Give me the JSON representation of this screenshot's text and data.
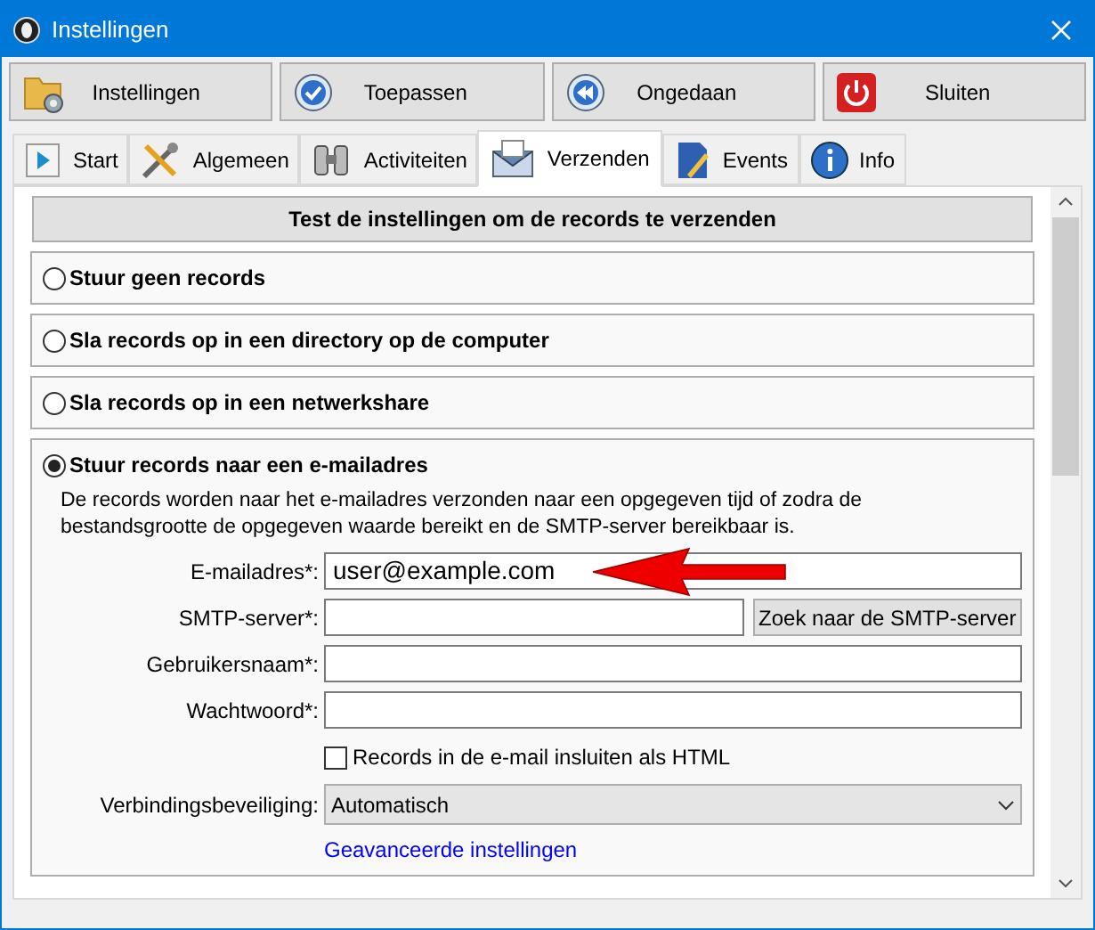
{
  "window": {
    "title": "Instellingen"
  },
  "toolbar": [
    {
      "label": "Instellingen",
      "kind": "folder"
    },
    {
      "label": "Toepassen",
      "kind": "check"
    },
    {
      "label": "Ongedaan",
      "kind": "undo"
    },
    {
      "label": "Sluiten",
      "kind": "power"
    }
  ],
  "tabs": [
    {
      "label": "Start",
      "kind": "play",
      "selected": false
    },
    {
      "label": "Algemeen",
      "kind": "tools",
      "selected": false
    },
    {
      "label": "Activiteiten",
      "kind": "binoculars",
      "selected": false
    },
    {
      "label": "Verzenden",
      "kind": "mail",
      "selected": true
    },
    {
      "label": "Events",
      "kind": "document",
      "selected": false
    },
    {
      "label": "Info",
      "kind": "info",
      "selected": false
    }
  ],
  "test_button": "Test de instellingen om de records te verzenden",
  "options": [
    {
      "label": "Stuur geen records",
      "selected": false
    },
    {
      "label": "Sla records op in een directory op de computer",
      "selected": false
    },
    {
      "label": "Sla records op in een netwerkshare",
      "selected": false
    },
    {
      "label": "Stuur records naar een e-mailadres",
      "selected": true
    }
  ],
  "email_form": {
    "description": "De records worden naar het e-mailadres verzonden naar een opgegeven tijd of zodra de bestandsgrootte de opgegeven waarde bereikt en de SMTP-server bereikbaar is.",
    "fields": [
      {
        "label": "E-mailadres*:",
        "value": "user@example.com",
        "kind": "annotated"
      },
      {
        "label": "SMTP-server*:",
        "button": "Zoek naar de SMTP-server",
        "kind": "with_button"
      },
      {
        "label": "Gebruikersnaam*:",
        "kind": "plain"
      },
      {
        "label": "Wachtwoord*:",
        "kind": "plain"
      }
    ],
    "checkbox": {
      "label": "Records in de e-mail insluiten als HTML",
      "checked": false
    },
    "security": {
      "label": "Verbindingsbeveiliging:",
      "value": "Automatisch"
    },
    "link": "Geavanceerde instellingen"
  }
}
